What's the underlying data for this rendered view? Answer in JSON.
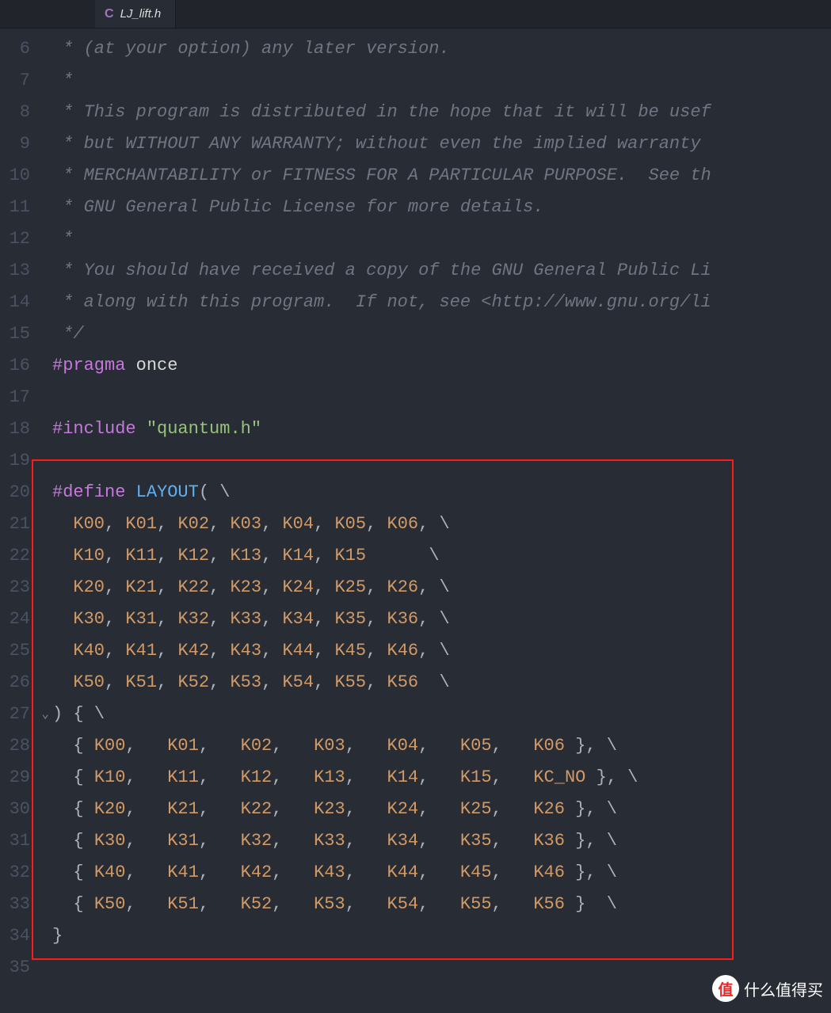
{
  "tab": {
    "icon_letter": "C",
    "filename": "LJ_lift.h"
  },
  "line_numbers": [
    "6",
    "7",
    "8",
    "9",
    "10",
    "11",
    "12",
    "13",
    "14",
    "15",
    "16",
    "17",
    "18",
    "19",
    "20",
    "21",
    "22",
    "23",
    "24",
    "25",
    "26",
    "27",
    "28",
    "29",
    "30",
    "31",
    "32",
    "33",
    "34",
    "35"
  ],
  "fold_on_line": "27",
  "fold_glyph": "⌄",
  "code": {
    "l6": " * (at your option) any later version.",
    "l7": " *",
    "l8": " * This program is distributed in the hope that it will be usef",
    "l9": " * but WITHOUT ANY WARRANTY; without even the implied warranty ",
    "l10": " * MERCHANTABILITY or FITNESS FOR A PARTICULAR PURPOSE.  See th",
    "l11": " * GNU General Public License for more details.",
    "l12": " *",
    "l13": " * You should have received a copy of the GNU General Public Li",
    "l14": " * along with this program.  If not, see <http://www.gnu.org/li",
    "l15": " */",
    "pragma": "#pragma",
    "once": "once",
    "include": "#include",
    "quantum": "\"quantum.h\"",
    "define": "#define",
    "layout": "LAYOUT",
    "r21": [
      "K00",
      "K01",
      "K02",
      "K03",
      "K04",
      "K05",
      "K06"
    ],
    "r22": [
      "K10",
      "K11",
      "K12",
      "K13",
      "K14",
      "K15"
    ],
    "r23": [
      "K20",
      "K21",
      "K22",
      "K23",
      "K24",
      "K25",
      "K26"
    ],
    "r24": [
      "K30",
      "K31",
      "K32",
      "K33",
      "K34",
      "K35",
      "K36"
    ],
    "r25": [
      "K40",
      "K41",
      "K42",
      "K43",
      "K44",
      "K45",
      "K46"
    ],
    "r26": [
      "K50",
      "K51",
      "K52",
      "K53",
      "K54",
      "K55",
      "K56"
    ],
    "m28": [
      "K00",
      "K01",
      "K02",
      "K03",
      "K04",
      "K05",
      "K06"
    ],
    "m29": [
      "K10",
      "K11",
      "K12",
      "K13",
      "K14",
      "K15",
      "KC_NO"
    ],
    "m30": [
      "K20",
      "K21",
      "K22",
      "K23",
      "K24",
      "K25",
      "K26"
    ],
    "m31": [
      "K30",
      "K31",
      "K32",
      "K33",
      "K34",
      "K35",
      "K36"
    ],
    "m32": [
      "K40",
      "K41",
      "K42",
      "K43",
      "K44",
      "K45",
      "K46"
    ],
    "m33": [
      "K50",
      "K51",
      "K52",
      "K53",
      "K54",
      "K55",
      "K56"
    ]
  },
  "watermark": {
    "badge": "值",
    "text": "什么值得买"
  }
}
